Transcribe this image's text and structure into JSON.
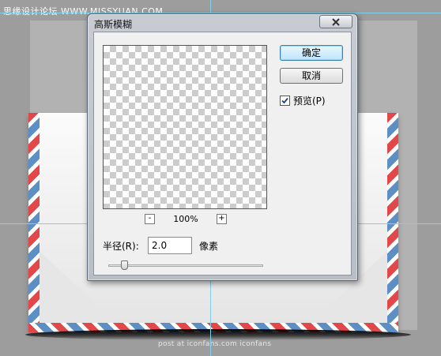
{
  "watermark": "思缘设计论坛 WWW.MISSYUAN.COM",
  "credit": "post at iconfans.com  iconfans",
  "dialog": {
    "title": "高斯模糊",
    "close_icon": "close-icon",
    "ok_label": "确定",
    "cancel_label": "取消",
    "preview_label": "预览(P)",
    "preview_checked": true,
    "zoom_out_label": "-",
    "zoom_in_label": "+",
    "zoom_level": "100%",
    "radius_label": "半径(R):",
    "radius_value": "2.0",
    "radius_unit": "像素",
    "radius_slider_fraction": 0.1
  },
  "colors": {
    "stripe_red": "#e24849",
    "stripe_blue": "#5d8fc4",
    "guide": "#7fd0ea",
    "ok_accent": "#3c7fb1"
  }
}
